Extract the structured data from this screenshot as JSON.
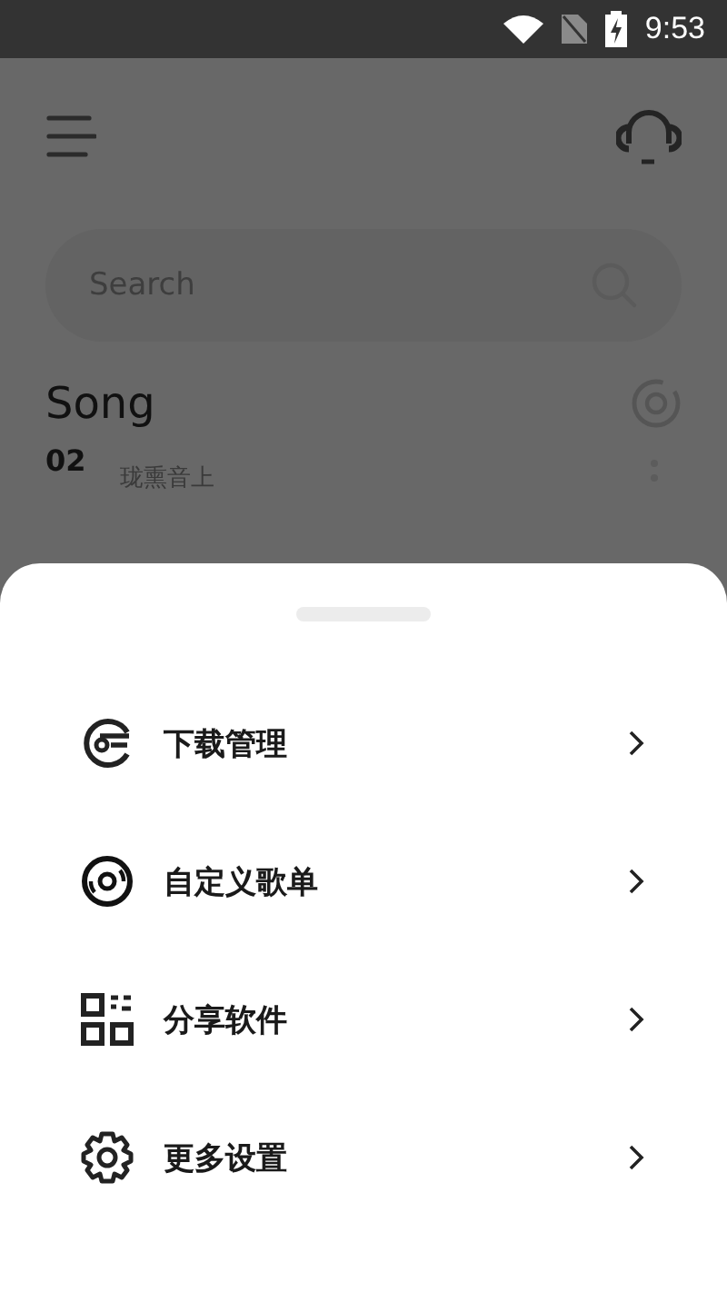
{
  "status_bar": {
    "time": "9:53"
  },
  "search": {
    "placeholder": "Search"
  },
  "section": {
    "title": "Song"
  },
  "song_row": {
    "number": "02",
    "title": "珑熏音上"
  },
  "menu": [
    {
      "kind": "download",
      "label": "下载管理"
    },
    {
      "kind": "disc",
      "label": "自定义歌单"
    },
    {
      "kind": "qr",
      "label": "分享软件"
    },
    {
      "kind": "gear",
      "label": "更多设置"
    }
  ]
}
